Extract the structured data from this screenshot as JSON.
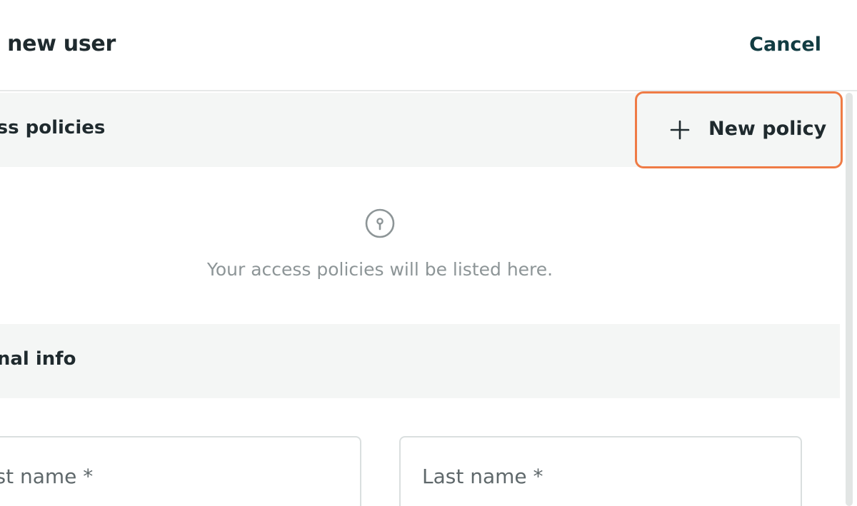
{
  "header": {
    "title": "l new user",
    "cancel_label": "Cancel"
  },
  "policies": {
    "section_title": "ess policies",
    "new_policy_label": "New policy",
    "empty_message": "Your access policies will be listed here.",
    "empty_icon": "key-circle-icon"
  },
  "personal": {
    "section_title": "onal info",
    "first_name_placeholder": "rst name *",
    "last_name_placeholder": "Last name *"
  },
  "colors": {
    "accent_outline": "#ef7b45",
    "cancel_text": "#123c42",
    "section_bg": "#f4f6f5"
  }
}
